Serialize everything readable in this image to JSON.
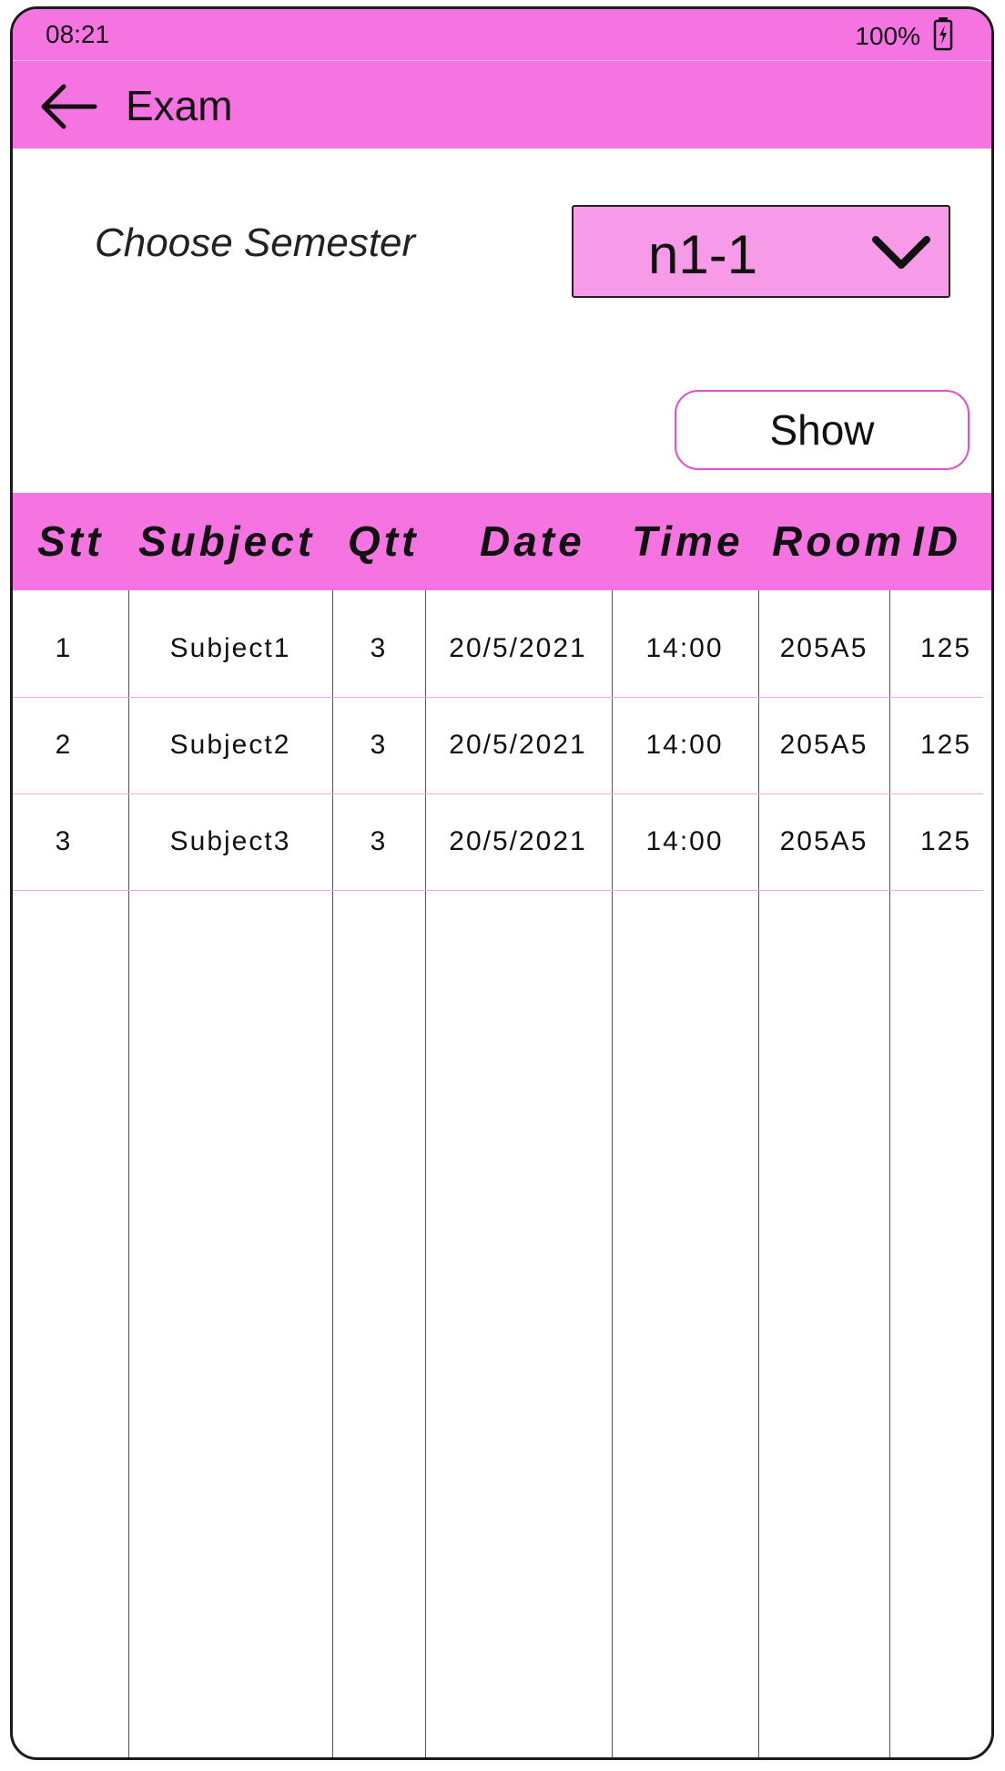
{
  "status_bar": {
    "time": "08:21",
    "battery": "100%"
  },
  "app_bar": {
    "title": "Exam"
  },
  "filter": {
    "label": "Choose Semester",
    "selected": "n1-1"
  },
  "show_button": {
    "label": "Show"
  },
  "table": {
    "headers": [
      "Stt",
      "Subject",
      "Qtt",
      "Date",
      "Time",
      "Room",
      "ID"
    ],
    "rows": [
      [
        "1",
        "Subject1",
        "3",
        "20/5/2021",
        "14:00",
        "205A5",
        "125"
      ],
      [
        "2",
        "Subject2",
        "3",
        "20/5/2021",
        "14:00",
        "205A5",
        "125"
      ],
      [
        "3",
        "Subject3",
        "3",
        "20/5/2021",
        "14:00",
        "205A5",
        "125"
      ]
    ]
  },
  "colors": {
    "accent": "#f574e2",
    "select_bg": "#f79be9",
    "button_border": "#e64bd2"
  }
}
